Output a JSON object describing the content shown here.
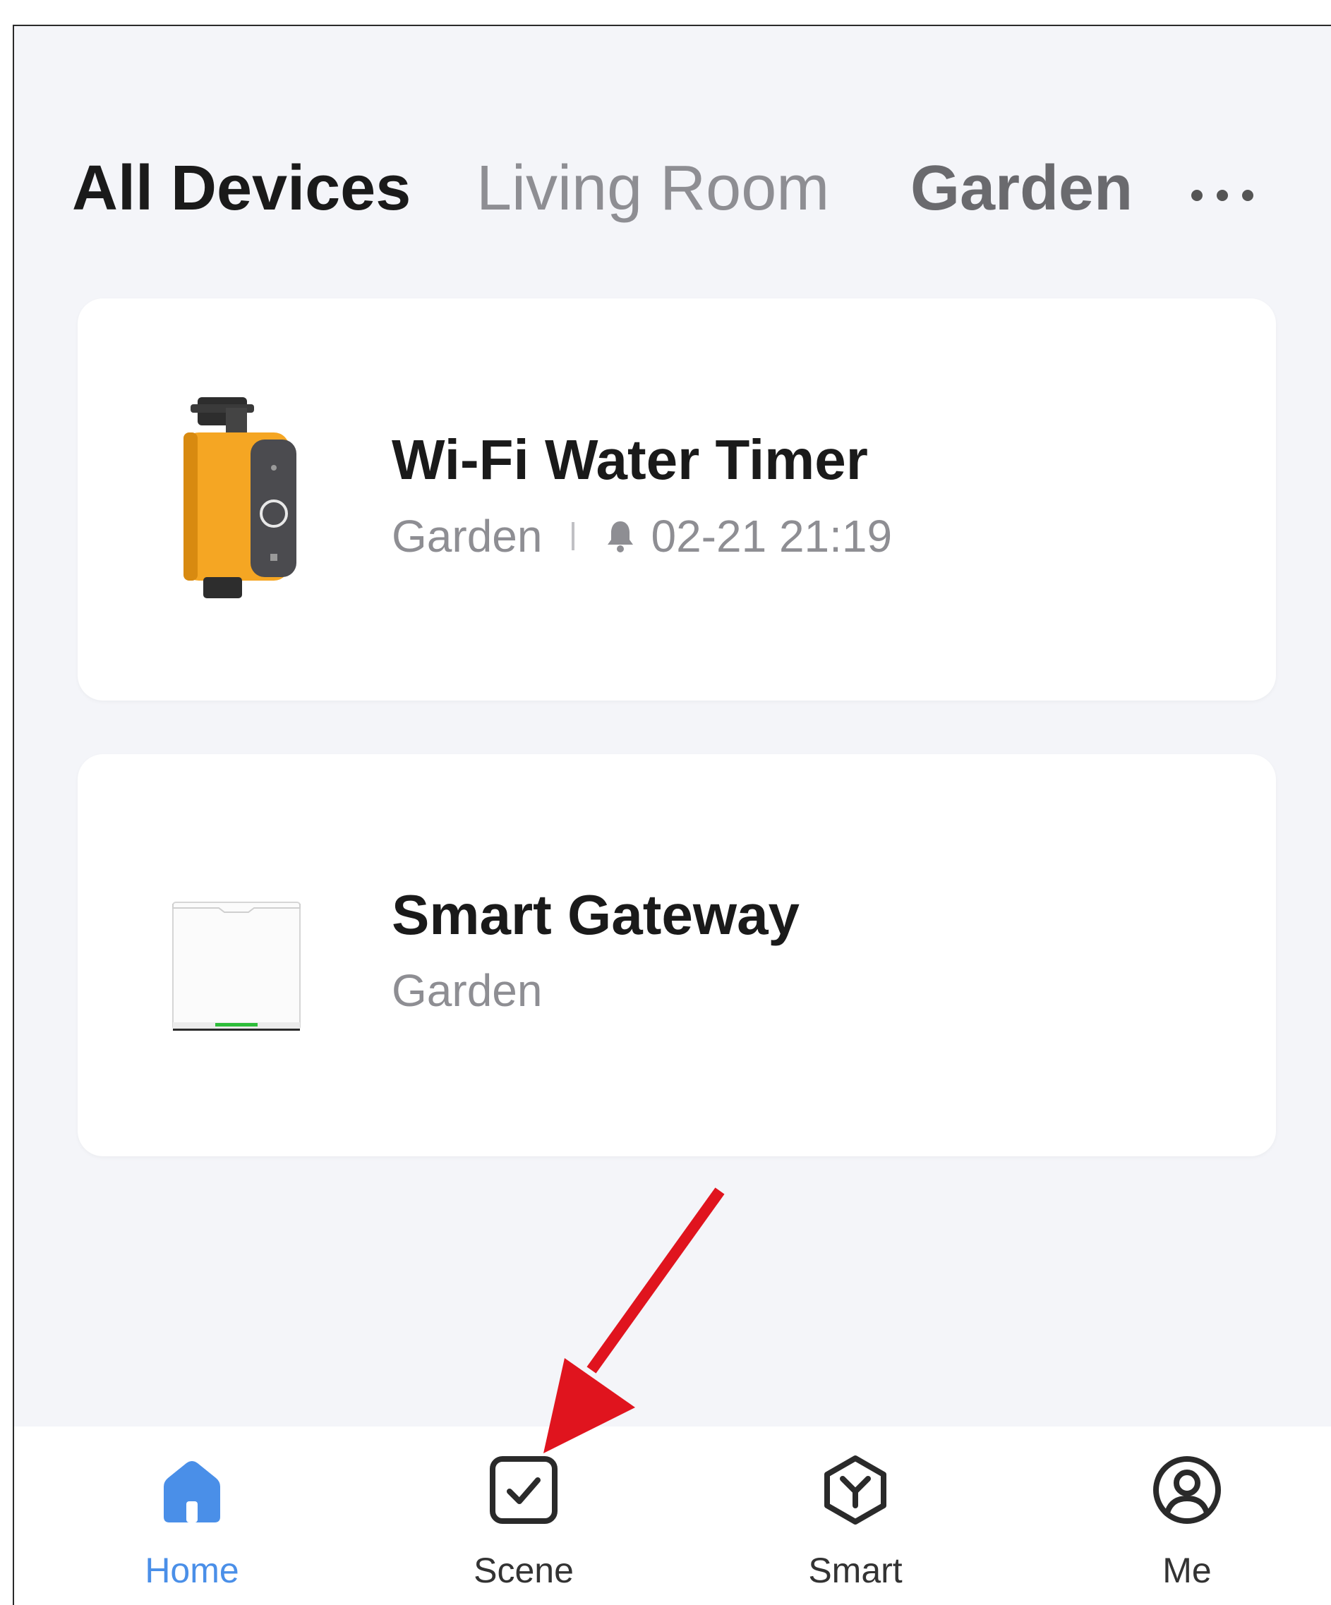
{
  "tabs": {
    "all_devices": "All Devices",
    "living_room": "Living Room",
    "garden": "Garden"
  },
  "devices": [
    {
      "name": "Wi-Fi Water Timer",
      "room": "Garden",
      "alert_time": "02-21 21:19"
    },
    {
      "name": "Smart Gateway",
      "room": "Garden"
    }
  ],
  "nav": {
    "home": "Home",
    "scene": "Scene",
    "smart": "Smart",
    "me": "Me"
  },
  "colors": {
    "accent": "#4a8fe8",
    "annotation_arrow": "#e0141e",
    "water_timer_body": "#f5a623",
    "gateway_led": "#2ebd3a"
  }
}
